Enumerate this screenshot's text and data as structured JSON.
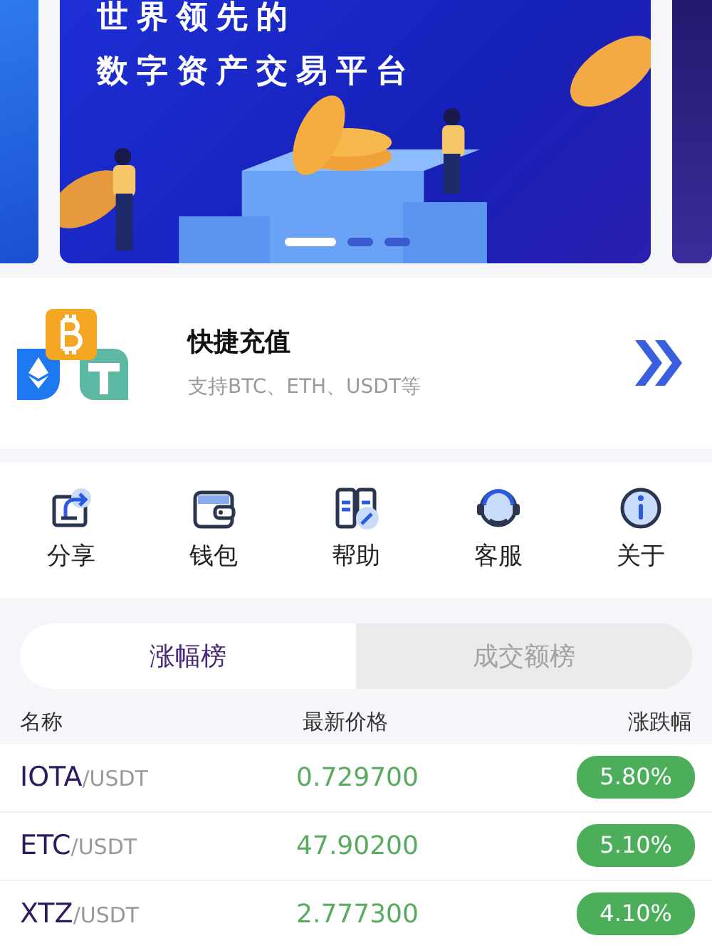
{
  "banner": {
    "title_lines": [
      "世界领先的",
      "数字资产交易平台"
    ],
    "slides": [
      {
        "selected": true
      },
      {
        "selected": false
      },
      {
        "selected": false
      }
    ]
  },
  "deposit": {
    "title": "快捷充值",
    "subtitle": "支持BTC、ETH、USDT等"
  },
  "shortcuts": [
    {
      "kind": "share",
      "label": "分享"
    },
    {
      "kind": "wallet",
      "label": "钱包"
    },
    {
      "kind": "help",
      "label": "帮助"
    },
    {
      "kind": "service",
      "label": "客服"
    },
    {
      "kind": "about",
      "label": "关于"
    }
  ],
  "tabs": [
    {
      "label": "涨幅榜",
      "selected": true
    },
    {
      "label": "成交额榜",
      "selected": false
    }
  ],
  "table": {
    "columns": [
      "名称",
      "最新价格",
      "涨跌幅"
    ],
    "rows": [
      {
        "base": "IOTA",
        "quote": "/USDT",
        "price": "0.729700",
        "change": "5.80%"
      },
      {
        "base": "ETC",
        "quote": "/USDT",
        "price": "47.90200",
        "change": "5.10%"
      },
      {
        "base": "XTZ",
        "quote": "/USDT",
        "price": "2.777300",
        "change": "4.10%"
      }
    ]
  }
}
